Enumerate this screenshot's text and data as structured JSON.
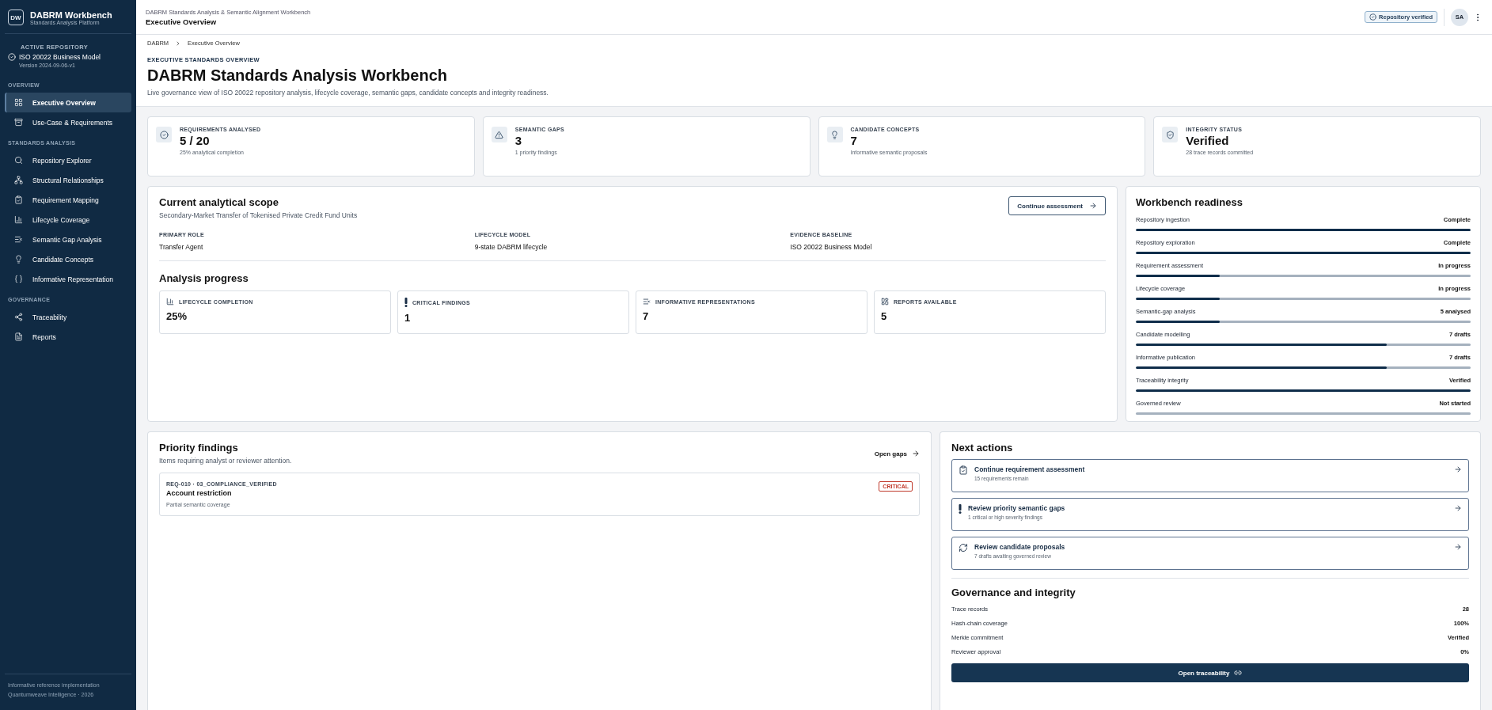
{
  "sidebar": {
    "logo": "DW",
    "title": "DABRM Workbench",
    "subtitle": "Standards Analysis Platform",
    "repository": {
      "label": "ACTIVE REPOSITORY",
      "name": "ISO 20022 Business Model",
      "version": "Version 2024-09-06-v1"
    },
    "sections": [
      {
        "heading": "OVERVIEW",
        "items": [
          {
            "label": "Executive Overview",
            "selected": true
          },
          {
            "label": "Use-Case & Requirements",
            "selected": false
          }
        ]
      },
      {
        "heading": "STANDARDS ANALYSIS",
        "items": [
          {
            "label": "Repository Explorer",
            "selected": false
          },
          {
            "label": "Structural Relationships",
            "selected": false
          },
          {
            "label": "Requirement Mapping",
            "selected": false
          },
          {
            "label": "Lifecycle Coverage",
            "selected": false
          },
          {
            "label": "Semantic Gap Analysis",
            "selected": false
          },
          {
            "label": "Candidate Concepts",
            "selected": false
          },
          {
            "label": "Informative Representation",
            "selected": false
          }
        ]
      },
      {
        "heading": "GOVERNANCE",
        "items": [
          {
            "label": "Traceability",
            "selected": false
          },
          {
            "label": "Reports",
            "selected": false
          }
        ]
      }
    ],
    "footer": [
      "Informative reference implementation",
      "Quantumweave Intelligence · 2026"
    ]
  },
  "topbar": {
    "context": "DABRM Standards Analysis & Semantic Alignment Workbench",
    "title": "Executive Overview",
    "status": "Repository verified",
    "avatar": "SA"
  },
  "breadcrumb": [
    "DABRM",
    "Executive Overview"
  ],
  "page": {
    "eyebrow": "EXECUTIVE STANDARDS OVERVIEW",
    "title": "DABRM Standards Analysis Workbench",
    "description": "Live governance view of ISO 20022 repository analysis, lifecycle coverage, semantic gaps, candidate concepts and integrity readiness."
  },
  "stats": [
    {
      "label": "REQUIREMENTS ANALYSED",
      "value": "5 / 20",
      "note": "25% analytical completion"
    },
    {
      "label": "SEMANTIC GAPS",
      "value": "3",
      "note": "1 priority findings"
    },
    {
      "label": "CANDIDATE CONCEPTS",
      "value": "7",
      "note": "Informative semantic proposals"
    },
    {
      "label": "INTEGRITY STATUS",
      "value": "Verified",
      "note": "28 trace records committed"
    }
  ],
  "scope": {
    "title": "Current analytical scope",
    "subtitle": "Secondary-Market Transfer of Tokenised Private Credit Fund Units",
    "action": "Continue assessment",
    "fields": [
      {
        "label": "PRIMARY ROLE",
        "value": "Transfer Agent"
      },
      {
        "label": "LIFECYCLE MODEL",
        "value": "9-state DABRM lifecycle"
      },
      {
        "label": "EVIDENCE BASELINE",
        "value": "ISO 20022 Business Model"
      }
    ],
    "progress_title": "Analysis progress",
    "progress": [
      {
        "label": "LIFECYCLE COMPLETION",
        "value": "25%"
      },
      {
        "label": "CRITICAL FINDINGS",
        "value": "1"
      },
      {
        "label": "INFORMATIVE REPRESENTATIONS",
        "value": "7"
      },
      {
        "label": "REPORTS AVAILABLE",
        "value": "5"
      }
    ]
  },
  "readiness": {
    "title": "Workbench readiness",
    "rows": [
      {
        "label": "Repository ingestion",
        "status": "Complete",
        "level": 1
      },
      {
        "label": "Repository exploration",
        "status": "Complete",
        "level": 1
      },
      {
        "label": "Requirement assessment",
        "status": "In progress",
        "level": 0.25
      },
      {
        "label": "Lifecycle coverage",
        "status": "In progress",
        "level": 0.25
      },
      {
        "label": "Semantic-gap analysis",
        "status": "5 analysed",
        "level": 0.25
      },
      {
        "label": "Candidate modelling",
        "status": "7 drafts",
        "level": 0.75
      },
      {
        "label": "Informative publication",
        "status": "7 drafts",
        "level": 0.75
      },
      {
        "label": "Traceability integrity",
        "status": "Verified",
        "level": 1
      },
      {
        "label": "Governed review",
        "status": "Not started",
        "level": 0
      }
    ]
  },
  "findings": {
    "title": "Priority findings",
    "subtitle": "Items requiring analyst or reviewer attention.",
    "action": "Open gaps",
    "items": [
      {
        "ref": "REQ-010 · 03_COMPLIANCE_VERIFIED",
        "title": "Account restriction",
        "detail": "Partial semantic coverage",
        "severity": "CRITICAL"
      }
    ]
  },
  "next_actions": {
    "title": "Next actions",
    "items": [
      {
        "title": "Continue requirement assessment",
        "detail": "15 requirements remain"
      },
      {
        "title": "Review priority semantic gaps",
        "detail": "1 critical or high severity findings"
      },
      {
        "title": "Review candidate proposals",
        "detail": "7 drafts awaiting governed review"
      }
    ]
  },
  "governance": {
    "title": "Governance and integrity",
    "rows": [
      {
        "label": "Trace records",
        "value": "28"
      },
      {
        "label": "Hash-chain coverage",
        "value": "100%"
      },
      {
        "label": "Merkle commitment",
        "value": "Verified"
      },
      {
        "label": "Reviewer approval",
        "value": "0%"
      }
    ],
    "action": "Open traceability"
  }
}
